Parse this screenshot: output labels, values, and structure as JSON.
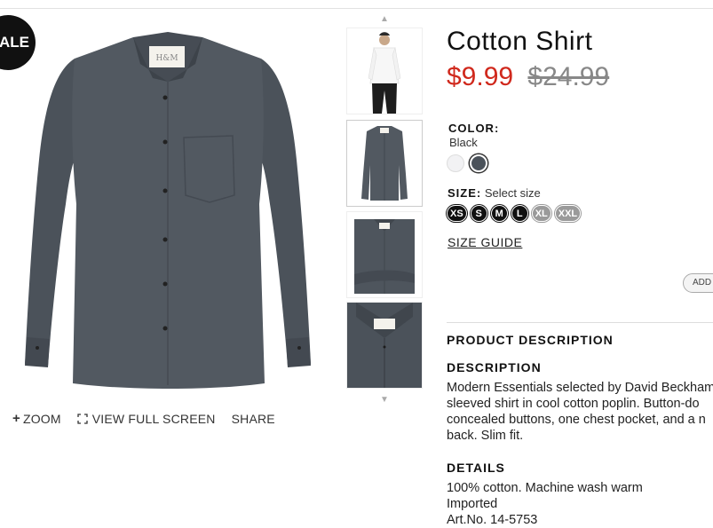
{
  "badge": {
    "sale": "ALE"
  },
  "image_actions": {
    "zoom": "ZOOM",
    "view_full_screen": "VIEW FULL SCREEN",
    "share": "SHARE"
  },
  "thumbnails": {
    "up_arrow": "▲",
    "down_arrow": "▼",
    "count": 4,
    "selected_index": 1
  },
  "product": {
    "name": "Cotton Shirt",
    "price": "$9.99",
    "old_price": "$24.99",
    "color_label": "COLOR:",
    "color_value": "Black",
    "swatches": [
      {
        "name": "white",
        "hex": "#f2f2f4"
      },
      {
        "name": "dark-grey",
        "hex": "#4b525a",
        "selected": true
      }
    ],
    "size_label": "SIZE:",
    "size_hint": "Select size",
    "sizes": [
      {
        "label": "XS",
        "available": true
      },
      {
        "label": "S",
        "available": true
      },
      {
        "label": "M",
        "available": true
      },
      {
        "label": "L",
        "available": true
      },
      {
        "label": "XL",
        "available": false
      },
      {
        "label": "XXL",
        "available": false
      }
    ],
    "size_guide": "SIZE GUIDE",
    "add_button": "ADD"
  },
  "description": {
    "section_title": "PRODUCT DESCRIPTION",
    "desc_title": "DESCRIPTION",
    "lines": [
      "Modern Essentials selected by David Beckham",
      "sleeved shirt in cool cotton poplin. Button-do",
      "concealed buttons, one chest pocket, and a n",
      "back. Slim fit."
    ],
    "details_title": "DETAILS",
    "details": [
      "100% cotton. Machine wash warm",
      "Imported",
      "Art.No. 14-5753"
    ]
  },
  "colors": {
    "price_red": "#d0281c",
    "shirt": "#4b525a",
    "text": "#222222"
  }
}
